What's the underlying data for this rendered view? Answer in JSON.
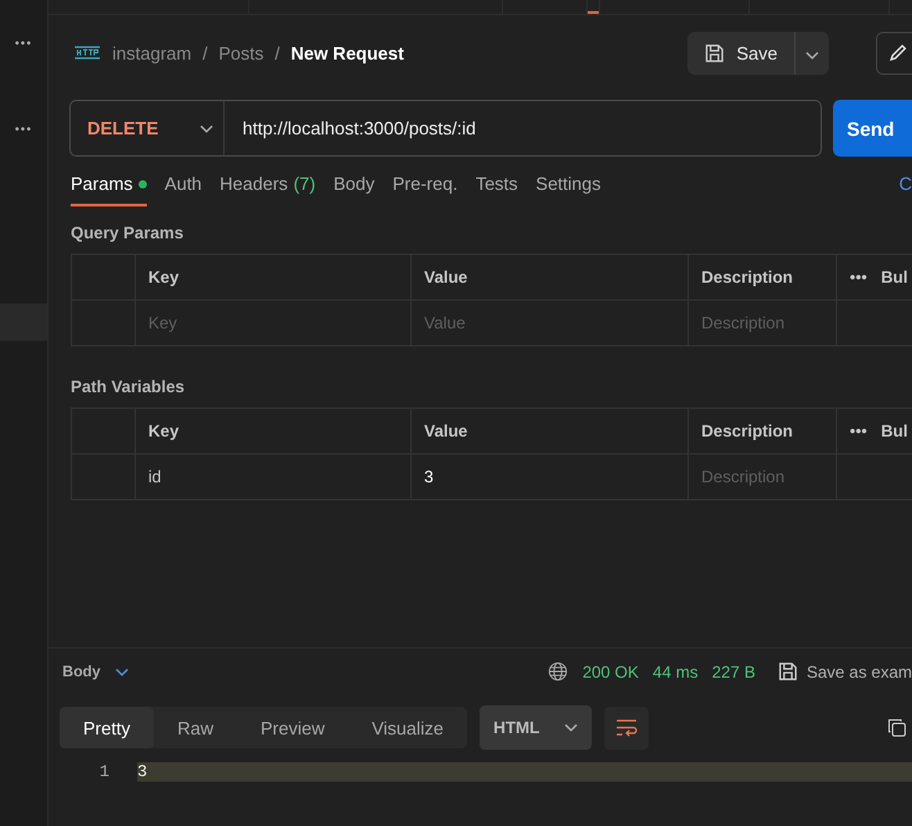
{
  "top_tabs": [
    {
      "selected": false
    },
    {
      "selected": false
    },
    {
      "selected": false
    },
    {
      "selected": true
    },
    {
      "selected": false
    },
    {
      "selected": false
    }
  ],
  "sidebar": {
    "more_buttons": [
      "•••",
      "•••"
    ]
  },
  "breadcrumb": {
    "parts": [
      "instagram",
      "Posts"
    ],
    "separator": "/",
    "current": "New Request"
  },
  "save_button": {
    "label": "Save"
  },
  "request": {
    "method": "DELETE",
    "url": "http://localhost:3000/posts/:id",
    "send_label": "Send"
  },
  "request_tabs": [
    {
      "label": "Params",
      "selected": true,
      "dot": true
    },
    {
      "label": "Auth",
      "selected": false
    },
    {
      "label": "Headers",
      "count": "(7)",
      "selected": false
    },
    {
      "label": "Body",
      "selected": false
    },
    {
      "label": "Pre-req.",
      "selected": false
    },
    {
      "label": "Tests",
      "selected": false
    },
    {
      "label": "Settings",
      "selected": false
    }
  ],
  "cookies_link": "C",
  "sections": [
    {
      "title": "Query Params",
      "columns": [
        "Key",
        "Value",
        "Description"
      ],
      "more": "•••",
      "bulk": "Bul",
      "rows": [
        {
          "key": "Key",
          "value": "Value",
          "description": "Description",
          "placeholder": true
        }
      ]
    },
    {
      "title": "Path Variables",
      "columns": [
        "Key",
        "Value",
        "Description"
      ],
      "more": "•••",
      "bulk": "Bul",
      "rows": [
        {
          "key": "id",
          "value": "3",
          "description": "Description",
          "placeholder": false
        }
      ]
    }
  ],
  "response": {
    "label": "Body",
    "status": "200 OK",
    "time": "44 ms",
    "size": "227 B",
    "save_example": "Save as exam",
    "views": [
      {
        "label": "Pretty",
        "selected": true
      },
      {
        "label": "Raw",
        "selected": false
      },
      {
        "label": "Preview",
        "selected": false
      },
      {
        "label": "Visualize",
        "selected": false
      }
    ],
    "format": "HTML",
    "lines": [
      {
        "number": "1",
        "text": "3",
        "highlighted": true
      }
    ]
  }
}
